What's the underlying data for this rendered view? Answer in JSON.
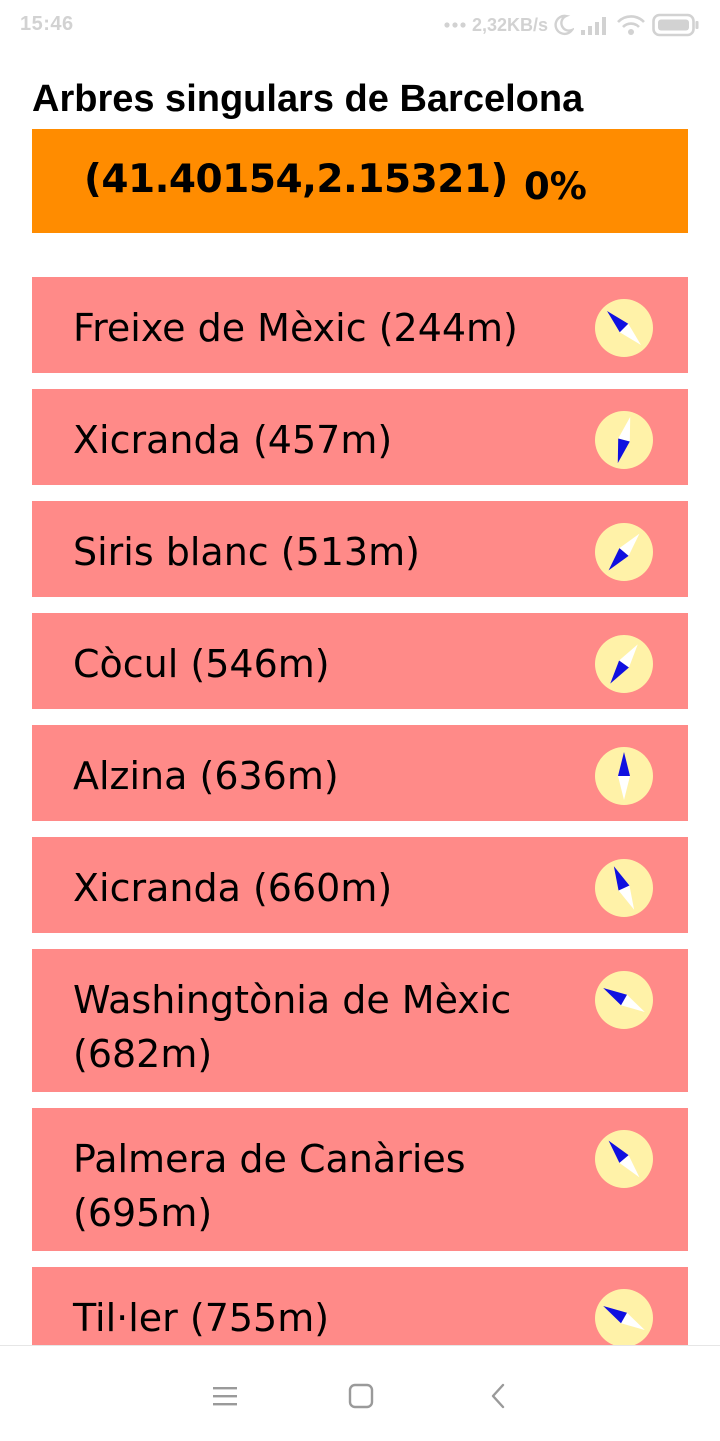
{
  "status_bar": {
    "time": "15:46",
    "network_speed": "2,32KB/s",
    "icons": [
      "dots-icon",
      "moon-icon",
      "signal-icon",
      "wifi-icon",
      "battery-icon"
    ]
  },
  "app": {
    "title": "Arbres singulars de Barcelona"
  },
  "location": {
    "coords": "(41.40154,2.15321)",
    "progress": "0%"
  },
  "colors": {
    "location_bar": "#ff8c00",
    "item_background": "#ff8a88",
    "compass_face": "#fff2a8",
    "compass_north": "#1010e0",
    "compass_south": "#ffffff"
  },
  "trees": [
    {
      "name": "Freixe de Mèxic (244m)",
      "bearing_deg": 315
    },
    {
      "name": "Xicranda (457m)",
      "bearing_deg": 195
    },
    {
      "name": "Siris blanc (513m)",
      "bearing_deg": 220
    },
    {
      "name": "Còcul (546m)",
      "bearing_deg": 215
    },
    {
      "name": "Alzina (636m)",
      "bearing_deg": 0
    },
    {
      "name": "Xicranda (660m)",
      "bearing_deg": 335
    },
    {
      "name": "Washingtònia de Mèxic (682m)",
      "bearing_deg": 300
    },
    {
      "name": "Palmera de Canàries (695m)",
      "bearing_deg": 320
    },
    {
      "name": "Til·ler (755m)",
      "bearing_deg": 300
    }
  ],
  "nav": {
    "icons": [
      "menu-icon",
      "home-icon",
      "back-icon"
    ]
  }
}
